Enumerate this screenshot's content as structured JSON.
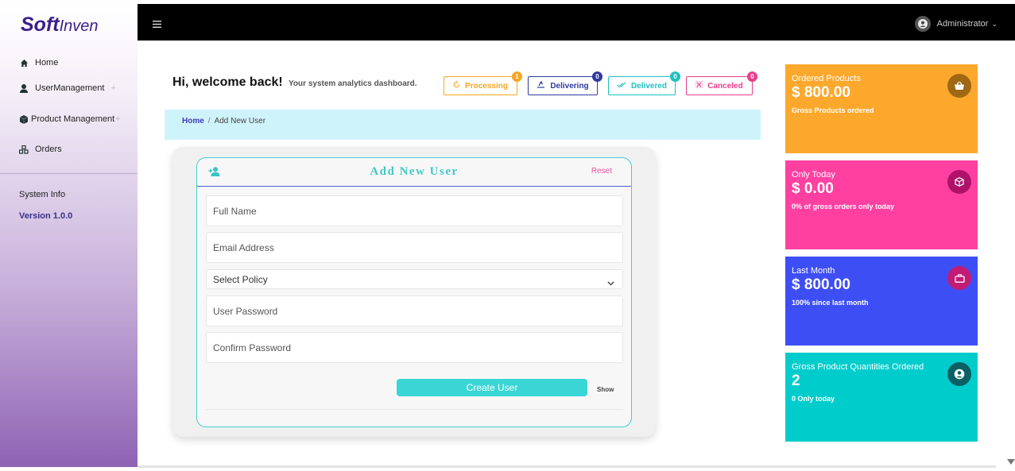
{
  "brand": {
    "logo_main": "Soft",
    "logo_sub": "Inven"
  },
  "sidebar": {
    "items": [
      {
        "label": "Home",
        "icon": "home-icon"
      },
      {
        "label": "UserManagement",
        "icon": "user-icon",
        "expand": "+"
      },
      {
        "label": "Product Management",
        "icon": "cube-icon",
        "expand": "+"
      },
      {
        "label": "Orders",
        "icon": "orders-icon"
      }
    ],
    "system_info": "System Info",
    "version": "Version 1.0.0"
  },
  "topbar": {
    "user": "Administrator",
    "caret": "⌄"
  },
  "header": {
    "welcome": "Hi, welcome back!",
    "subtitle": "Your system analytics dashboard."
  },
  "status": [
    {
      "label": "Processing",
      "count": "1",
      "color": "#f5a623",
      "icon": "refresh-icon"
    },
    {
      "label": "Delivering",
      "count": "0",
      "color": "#2d3a9e",
      "icon": "delivery-icon"
    },
    {
      "label": "Delivered",
      "count": "0",
      "color": "#20c0c0",
      "icon": "check-double-icon"
    },
    {
      "label": "Canceled",
      "count": "0",
      "color": "#e83e8c",
      "icon": "cancel-icon"
    }
  ],
  "breadcrumb": {
    "home": "Home",
    "separator": "/",
    "current": "Add New User"
  },
  "form": {
    "title": "Add New User",
    "reset": "Reset",
    "fields": {
      "full_name": "Full Name",
      "email": "Email Address",
      "policy": "Select Policy",
      "password": "User Password",
      "confirm": "Confirm Password"
    },
    "submit": "Create User",
    "show": "Show"
  },
  "cards": [
    {
      "label": "Ordered Products",
      "value": "$ 800.00",
      "desc": "Gross Products ordered",
      "bg": "#fca82d",
      "icon_bg": "#a06714",
      "icon": "basket-icon"
    },
    {
      "label": "Only Today",
      "value": "$ 0.00",
      "desc": "0% of gross orders only today",
      "bg": "#ff40a1",
      "icon_bg": "#b0126a",
      "icon": "box-icon"
    },
    {
      "label": "Last Month",
      "value": "$ 800.00",
      "desc": "100% since last month",
      "bg": "#3e4ef5",
      "icon_bg": "#c21b74",
      "icon": "briefcase-icon"
    },
    {
      "label": "Gross Product Quantities Ordered",
      "value": "2",
      "desc": "0 Only today",
      "bg": "#00cccc",
      "icon_bg": "#0b5f65",
      "icon": "user-circle-icon"
    }
  ]
}
